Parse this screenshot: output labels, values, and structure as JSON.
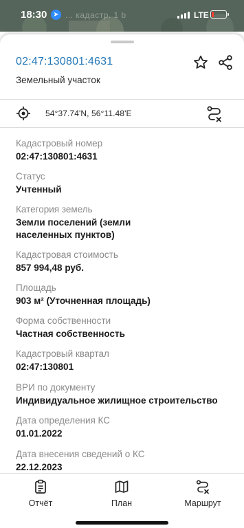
{
  "status_bar": {
    "time": "18:30",
    "faint_text": "... кадастр. 1 b",
    "network": "LTE",
    "battery_level": 0.18,
    "battery_color": "#ff3b30"
  },
  "sheet": {
    "cadastral_title": "02:47:130801:4631",
    "subtitle": "Земельный участок",
    "title_color": "#2377b8",
    "icons": {
      "favorite": "star-icon",
      "share": "share-icon",
      "locate": "crosshair-icon",
      "route_clear": "route-clear-icon"
    },
    "coordinates": "54°37.74'N, 56°11.48'E"
  },
  "fields": [
    {
      "label": "Кадастровый номер",
      "value": "02:47:130801:4631"
    },
    {
      "label": "Статус",
      "value": "Учтенный"
    },
    {
      "label": "Категория земель",
      "value": "Земли поселений (земли населенных пунктов)"
    },
    {
      "label": "Кадастровая стоимость",
      "value": "857 994,48 руб."
    },
    {
      "label": "Площадь",
      "value": "903 м² (Уточненная площадь)"
    },
    {
      "label": "Форма собственности",
      "value": "Частная собственность"
    },
    {
      "label": "Кадастровый квартал",
      "value": "02:47:130801"
    },
    {
      "label": "ВРИ по документу",
      "value": "Индивидуальное жилищное строительство"
    },
    {
      "label": "Дата определения КС",
      "value": "01.01.2022"
    },
    {
      "label": "Дата внесения сведений о КС",
      "value": "22.12.2023"
    }
  ],
  "bottom_nav": {
    "report": {
      "label": "Отчёт",
      "icon": "clipboard-icon"
    },
    "plan": {
      "label": "План",
      "icon": "map-icon"
    },
    "route": {
      "label": "Маршрут",
      "icon": "route-icon"
    }
  }
}
